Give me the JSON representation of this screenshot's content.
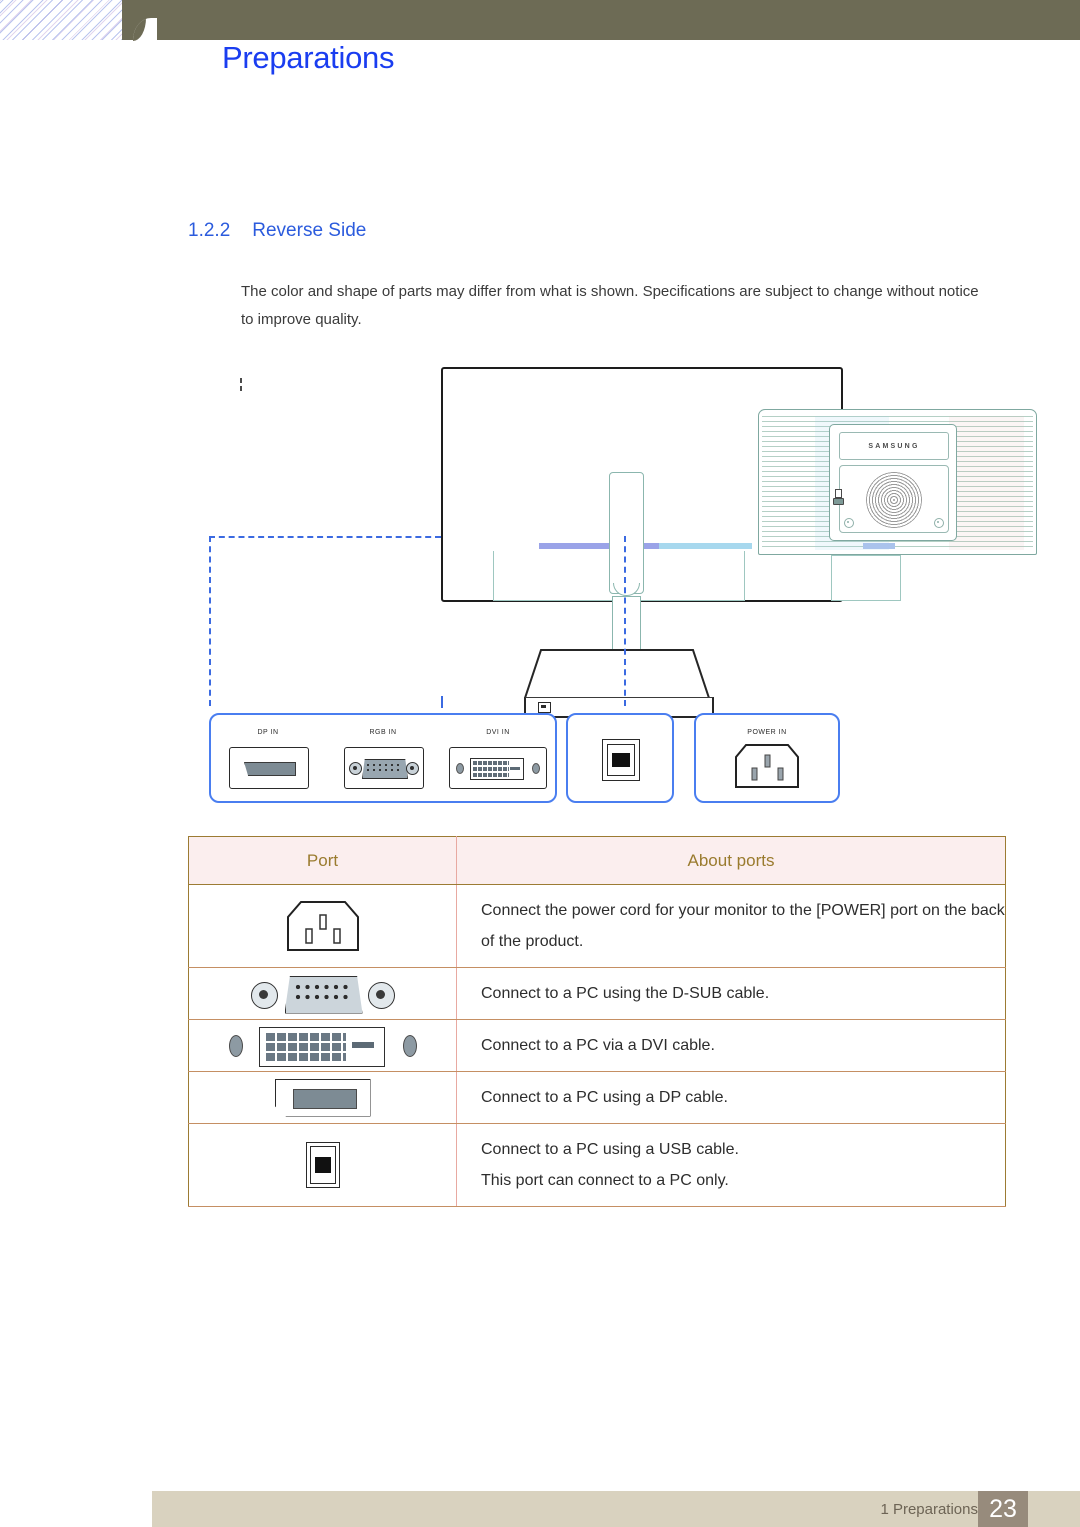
{
  "header": {
    "title": "Preparations",
    "bar_color": "#6d6b55",
    "title_color": "#1a3df0"
  },
  "section": {
    "number": "1.2.2",
    "title": "Reverse Side",
    "heading_color": "#2b5bdd",
    "note": "The color and shape of parts may differ from what is shown. Specifications are subject to change without notice to improve quality."
  },
  "illustration": {
    "brand_logo": "SAMSUNG",
    "callout_color": "#4a7ef0",
    "callout_groups": [
      {
        "id": "video-ports",
        "labels": [
          "DP IN",
          "RGB IN",
          "DVI IN"
        ]
      },
      {
        "id": "usb-port",
        "labels": [
          ""
        ]
      },
      {
        "id": "power-port",
        "labels": [
          "POWER IN"
        ]
      }
    ],
    "icons": {
      "lock": "kensington-lock-icon",
      "dp": "displayport-connector-icon",
      "vga": "vga-dsub-connector-icon",
      "dvi": "dvi-connector-icon",
      "usb": "usb-b-connector-icon",
      "power": "iec-power-inlet-icon"
    }
  },
  "table": {
    "header_bg": "#fbeeee",
    "header_text_color": "#9a7b2e",
    "border_color": "#9c7b33",
    "columns": [
      "Port",
      "About ports"
    ],
    "rows": [
      {
        "icon": "iec-power-inlet-icon",
        "lines": [
          "Connect the power cord for your monitor to the [POWER] port on the back of the product."
        ]
      },
      {
        "icon": "vga-dsub-connector-icon",
        "lines": [
          "Connect to a PC using the D-SUB cable."
        ]
      },
      {
        "icon": "dvi-connector-icon",
        "lines": [
          "Connect to a PC via a DVI cable."
        ]
      },
      {
        "icon": "displayport-connector-icon",
        "lines": [
          "Connect to a PC using a DP cable."
        ]
      },
      {
        "icon": "usb-b-connector-icon",
        "lines": [
          "Connect to a PC using a USB cable.",
          "This port can connect to a PC only."
        ]
      }
    ]
  },
  "footer": {
    "chapter": "1 Preparations",
    "page_number": "23",
    "bar_color": "#d9d2bf",
    "page_box_color": "#978b7c"
  }
}
